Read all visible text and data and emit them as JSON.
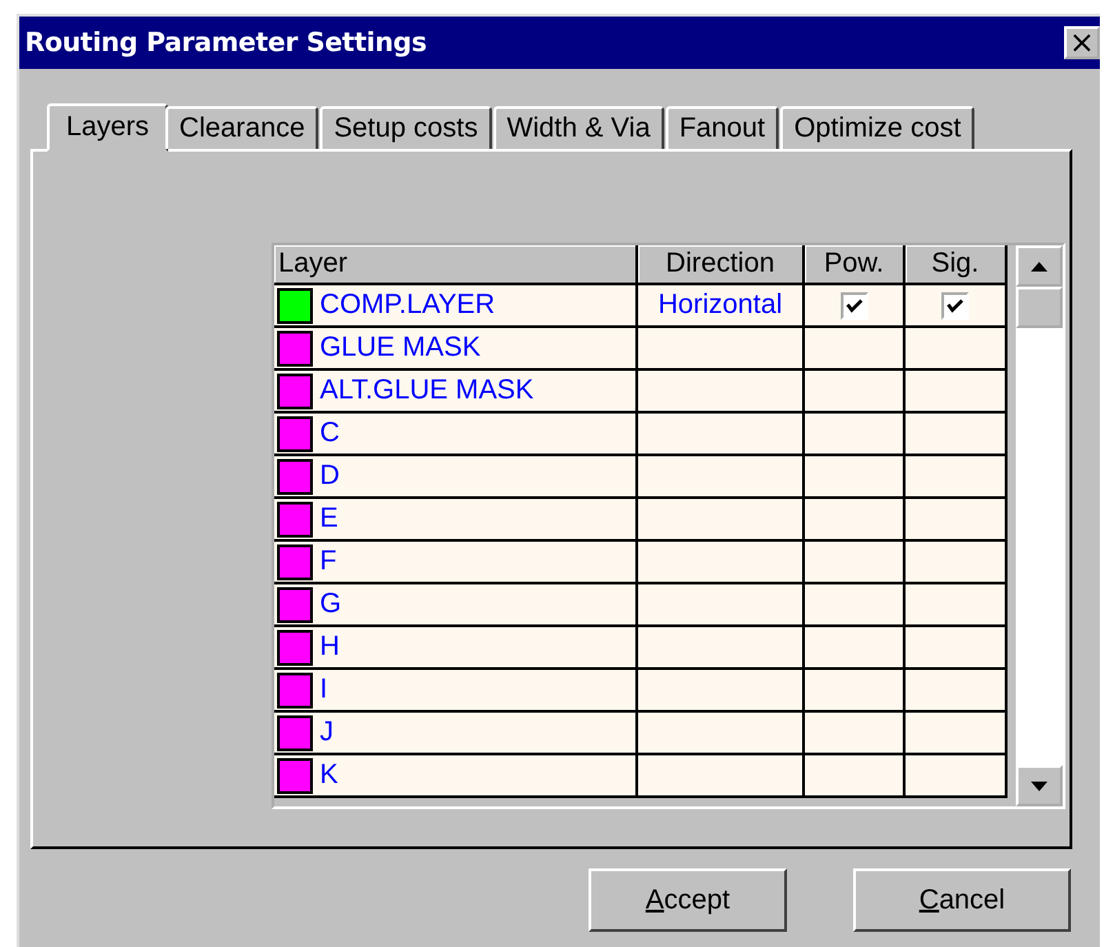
{
  "window": {
    "title": "Routing Parameter Settings",
    "close": "×"
  },
  "tabs": [
    {
      "label": "Layers",
      "selected": true
    },
    {
      "label": "Clearance",
      "selected": false
    },
    {
      "label": "Setup costs",
      "selected": false
    },
    {
      "label": "Width & Via",
      "selected": false
    },
    {
      "label": "Fanout",
      "selected": false
    },
    {
      "label": "Optimize cost",
      "selected": false
    }
  ],
  "table": {
    "columns": [
      "Layer",
      "Direction",
      "Pow.",
      "Sig."
    ],
    "rows": [
      {
        "name": "COMP.LAYER",
        "color": "#00ff00",
        "direction": "Horizontal",
        "power": {
          "checked": true
        },
        "signal": {
          "checked": true
        }
      },
      {
        "name": "GLUE MASK",
        "color": "#ff00ff"
      },
      {
        "name": "ALT.GLUE MASK",
        "color": "#ff00ff"
      },
      {
        "name": "C",
        "color": "#ff00ff"
      },
      {
        "name": "D",
        "color": "#ff00ff"
      },
      {
        "name": "E",
        "color": "#ff00ff"
      },
      {
        "name": "F",
        "color": "#ff00ff"
      },
      {
        "name": "G",
        "color": "#ff00ff"
      },
      {
        "name": "H",
        "color": "#ff00ff"
      },
      {
        "name": "I",
        "color": "#ff00ff"
      },
      {
        "name": "J",
        "color": "#ff00ff"
      },
      {
        "name": "K",
        "color": "#ff00ff"
      }
    ]
  },
  "buttons": [
    {
      "key": "A",
      "rest": "ccept"
    },
    {
      "key": "C",
      "rest": "ancel"
    }
  ]
}
